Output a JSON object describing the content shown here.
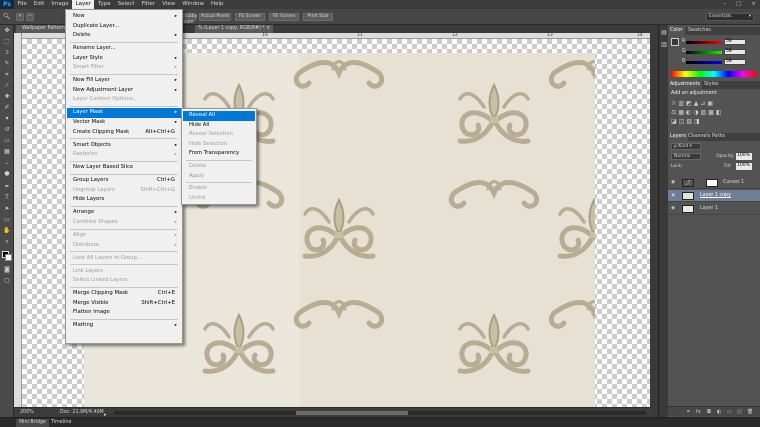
{
  "app": {
    "logo": "Ps"
  },
  "menubar": {
    "items": [
      "File",
      "Edit",
      "Image",
      "Layer",
      "Type",
      "Select",
      "Filter",
      "View",
      "Window",
      "Help"
    ],
    "active": "Layer"
  },
  "window_controls": {
    "minimize": "–",
    "restore": "□",
    "close": "×"
  },
  "options_bar": {
    "buttons": [
      "Zoom All Windows",
      "Scrubby Zoom",
      "Actual Pixels",
      "Fit Screen",
      "Fill Screen",
      "Print Size"
    ],
    "visible_labels": [
      "Scrubby Zoom",
      "Actual Pixels",
      "Fit Screen",
      "Fill Screen",
      "Print Size"
    ],
    "workspace": "Essentials"
  },
  "document_tab": {
    "title": "Wallpaper Pattern.psd @ 200% (Layer 1 copy, RGB/8#) *",
    "visible_title": "Wallpaper Pattern...",
    "right_fragment": "% (Layer 1 copy, RGB/8#) *",
    "close": "×"
  },
  "ruler": {
    "top_numbers": [
      "10",
      "11",
      "12",
      "13",
      "14"
    ]
  },
  "layer_menu": {
    "items": [
      {
        "label": "New",
        "submenu": true
      },
      {
        "label": "Duplicate Layer..."
      },
      {
        "label": "Delete",
        "submenu": true
      },
      {
        "sep": true
      },
      {
        "label": "Rename Layer..."
      },
      {
        "label": "Layer Style",
        "submenu": true
      },
      {
        "label": "Smart Filter",
        "disabled": true,
        "submenu": true
      },
      {
        "sep": true
      },
      {
        "label": "New Fill Layer",
        "submenu": true
      },
      {
        "label": "New Adjustment Layer",
        "submenu": true
      },
      {
        "label": "Layer Content Options...",
        "disabled": true
      },
      {
        "sep": true
      },
      {
        "label": "Layer Mask",
        "submenu": true,
        "highlighted": true
      },
      {
        "label": "Vector Mask",
        "submenu": true
      },
      {
        "label": "Create Clipping Mask",
        "shortcut": "Alt+Ctrl+G"
      },
      {
        "sep": true
      },
      {
        "label": "Smart Objects",
        "submenu": true
      },
      {
        "label": "Rasterize",
        "disabled": true,
        "submenu": true
      },
      {
        "sep": true
      },
      {
        "label": "New Layer Based Slice"
      },
      {
        "sep": true
      },
      {
        "label": "Group Layers",
        "shortcut": "Ctrl+G"
      },
      {
        "label": "Ungroup Layers",
        "shortcut": "Shift+Ctrl+G",
        "disabled": true
      },
      {
        "label": "Hide Layers"
      },
      {
        "sep": true
      },
      {
        "label": "Arrange",
        "submenu": true
      },
      {
        "label": "Combine Shapes",
        "disabled": true,
        "submenu": true
      },
      {
        "sep": true
      },
      {
        "label": "Align",
        "disabled": true,
        "submenu": true
      },
      {
        "label": "Distribute",
        "disabled": true,
        "submenu": true
      },
      {
        "sep": true
      },
      {
        "label": "Lock All Layers in Group...",
        "disabled": true
      },
      {
        "sep": true
      },
      {
        "label": "Link Layers",
        "disabled": true
      },
      {
        "label": "Select Linked Layers",
        "disabled": true
      },
      {
        "sep": true
      },
      {
        "label": "Merge Clipping Mask",
        "shortcut": "Ctrl+E"
      },
      {
        "label": "Merge Visible",
        "shortcut": "Shift+Ctrl+E"
      },
      {
        "label": "Flatten Image"
      },
      {
        "sep": true
      },
      {
        "label": "Matting",
        "submenu": true
      }
    ]
  },
  "layer_mask_submenu": {
    "items": [
      {
        "label": "Reveal All",
        "highlighted": true
      },
      {
        "label": "Hide All"
      },
      {
        "label": "Reveal Selection",
        "disabled": true
      },
      {
        "label": "Hide Selection",
        "disabled": true
      },
      {
        "label": "From Transparency"
      },
      {
        "sep": true
      },
      {
        "label": "Delete",
        "disabled": true
      },
      {
        "label": "Apply",
        "disabled": true
      },
      {
        "sep": true
      },
      {
        "label": "Enable",
        "disabled": true
      },
      {
        "label": "Unlink",
        "disabled": true
      }
    ]
  },
  "status_bar": {
    "zoom": "200%",
    "doc": "Doc: 21.9M/4.40M"
  },
  "bottom_tabs": [
    "Mini Bridge",
    "Timeline"
  ],
  "color_panel": {
    "tabs": [
      "Color",
      "Swatches"
    ],
    "channels": [
      {
        "label": "R",
        "value": "58",
        "color": "#e04040"
      },
      {
        "label": "G",
        "value": "58",
        "color": "#40c040"
      },
      {
        "label": "B",
        "value": "58",
        "color": "#4060e0"
      }
    ]
  },
  "adjustments_panel": {
    "tabs": [
      "Adjustments",
      "Styles"
    ],
    "heading": "Add an adjustment"
  },
  "layers_panel": {
    "tabs": [
      "Layers",
      "Channels",
      "Paths"
    ],
    "kind": "Kind",
    "blend_mode": "Normal",
    "opacity_label": "Opacity:",
    "opacity": "100%",
    "lock_label": "Lock:",
    "fill_label": "Fill:",
    "fill": "100%",
    "layers": [
      {
        "name": "Curves 1",
        "selected": false
      },
      {
        "name": "Layer 1 copy",
        "selected": true
      },
      {
        "name": "Layer 1",
        "selected": false
      }
    ],
    "footer_icons": [
      "link-icon",
      "fx-icon",
      "mask-icon",
      "adjustment-icon",
      "folder-icon",
      "new-layer-icon",
      "trash-icon"
    ]
  },
  "colors": {
    "accent": "#0078d7",
    "menu_bg": "#f0f0f0",
    "panel_bg": "#535353"
  }
}
